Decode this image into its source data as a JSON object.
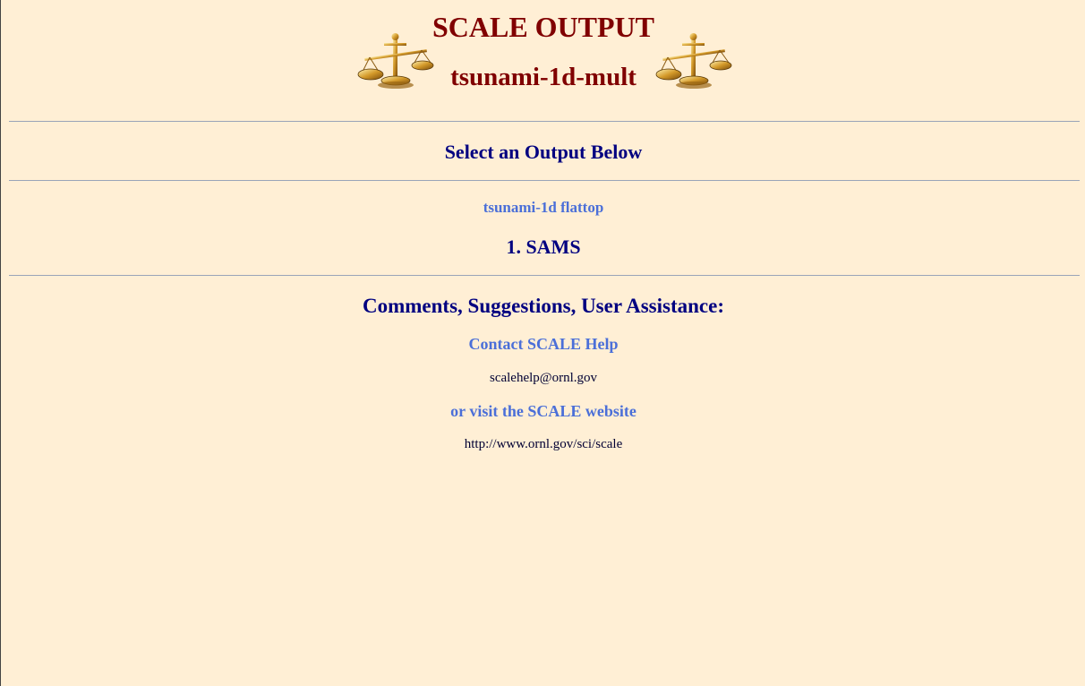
{
  "header": {
    "title": "SCALE OUTPUT",
    "subtitle": "tsunami-1d-mult",
    "left_icon": "balance-scale-icon",
    "right_icon": "balance-scale-icon"
  },
  "select_heading": "Select an Output Below",
  "outputs": {
    "case_link": "tsunami-1d flattop",
    "items": [
      {
        "label": "1. SAMS"
      }
    ]
  },
  "footer": {
    "heading": "Comments, Suggestions, User Assistance:",
    "contact_label": "Contact SCALE Help",
    "email": "scalehelp@ornl.gov",
    "visit_label": "or visit the SCALE website",
    "url": "http://www.ornl.gov/sci/scale"
  },
  "colors": {
    "background": "#ffefd5",
    "title": "#800000",
    "heading": "#000080",
    "link": "#4b6fd8"
  }
}
